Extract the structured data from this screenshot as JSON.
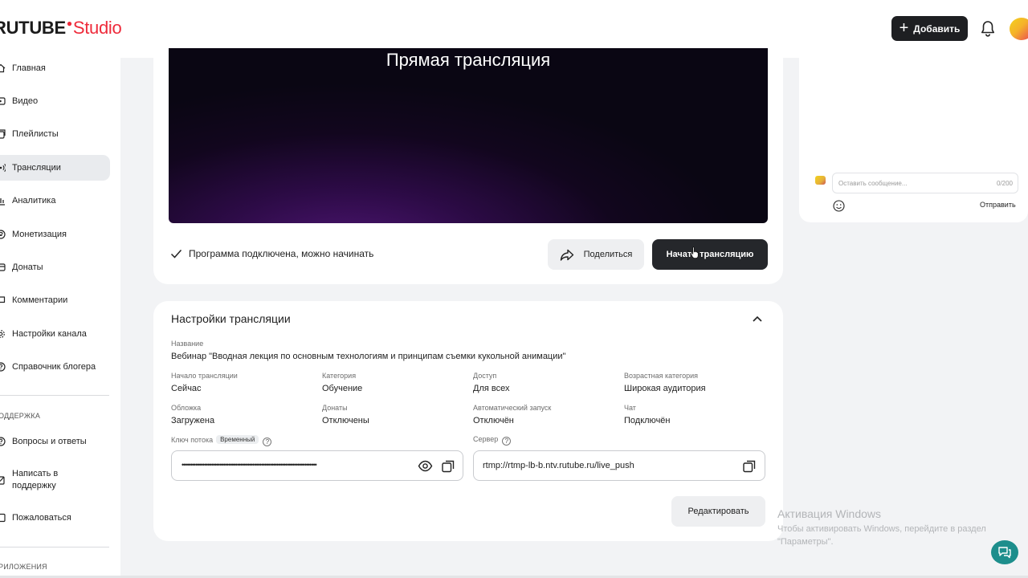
{
  "header": {
    "logo_main": "RUTUBE",
    "logo_studio": "Studio",
    "add_label": "Добавить"
  },
  "sidebar": {
    "items": [
      {
        "label": "Главная",
        "icon": "home-icon"
      },
      {
        "label": "Видео",
        "icon": "video-icon"
      },
      {
        "label": "Плейлисты",
        "icon": "playlist-icon"
      },
      {
        "label": "Трансляции",
        "icon": "broadcast-icon",
        "active": true
      },
      {
        "label": "Аналитика",
        "icon": "analytics-icon"
      },
      {
        "label": "Монетизация",
        "icon": "money-icon"
      },
      {
        "label": "Донаты",
        "icon": "donate-icon"
      },
      {
        "label": "Комментарии",
        "icon": "comment-icon"
      },
      {
        "label": "Настройки канала",
        "icon": "gear-icon"
      },
      {
        "label": "Справочник блогера",
        "icon": "help-circle-icon"
      }
    ],
    "support_section": "ОДДЕРЖКА",
    "support_items": [
      {
        "label": "Вопросы и ответы",
        "icon": "help-circle-icon"
      },
      {
        "label": "Написать в поддержку",
        "icon": "edit-icon"
      },
      {
        "label": "Пожаловаться",
        "icon": "flag-icon"
      }
    ],
    "apps_section": "РИЛОЖЕНИЯ"
  },
  "player": {
    "title": "Прямая трансляция"
  },
  "stream": {
    "status": "Программа подключена, можно начинать",
    "share_label": "Поделиться",
    "start_label": "Начать трансляцию"
  },
  "settings": {
    "title": "Настройки трансляции",
    "name_label": "Название",
    "name_value": "Вебинар \"Вводная лекция по основным технологиям и принципам съемки кукольной анимации\"",
    "fields": [
      {
        "label": "Начало трансляции",
        "value": "Сейчас"
      },
      {
        "label": "Категория",
        "value": "Обучение"
      },
      {
        "label": "Доступ",
        "value": "Для всех"
      },
      {
        "label": "Возрастная категория",
        "value": "Широкая аудитория"
      },
      {
        "label": "Обложка",
        "value": "Загружена"
      },
      {
        "label": "Донаты",
        "value": "Отключены"
      },
      {
        "label": "Автоматический запуск",
        "value": "Отключён"
      },
      {
        "label": "Чат",
        "value": "Подключён"
      }
    ],
    "key_label": "Ключ потока",
    "key_badge": "Временный",
    "key_value": "••••••••••••••••••••••••••••••••••••••••••••••••••••••••••••••••••••••••••••••",
    "server_label": "Сервер",
    "server_value": "rtmp://rtmp-lb-b.ntv.rutube.ru/live_push",
    "edit_label": "Редактировать"
  },
  "chat": {
    "placeholder": "Оставить сообщение...",
    "counter": "0/200",
    "send_label": "Отправить"
  },
  "watermark": {
    "title": "Активация Windows",
    "subtitle": "Чтобы активировать Windows, перейдите в раздел \"Параметры\"."
  }
}
